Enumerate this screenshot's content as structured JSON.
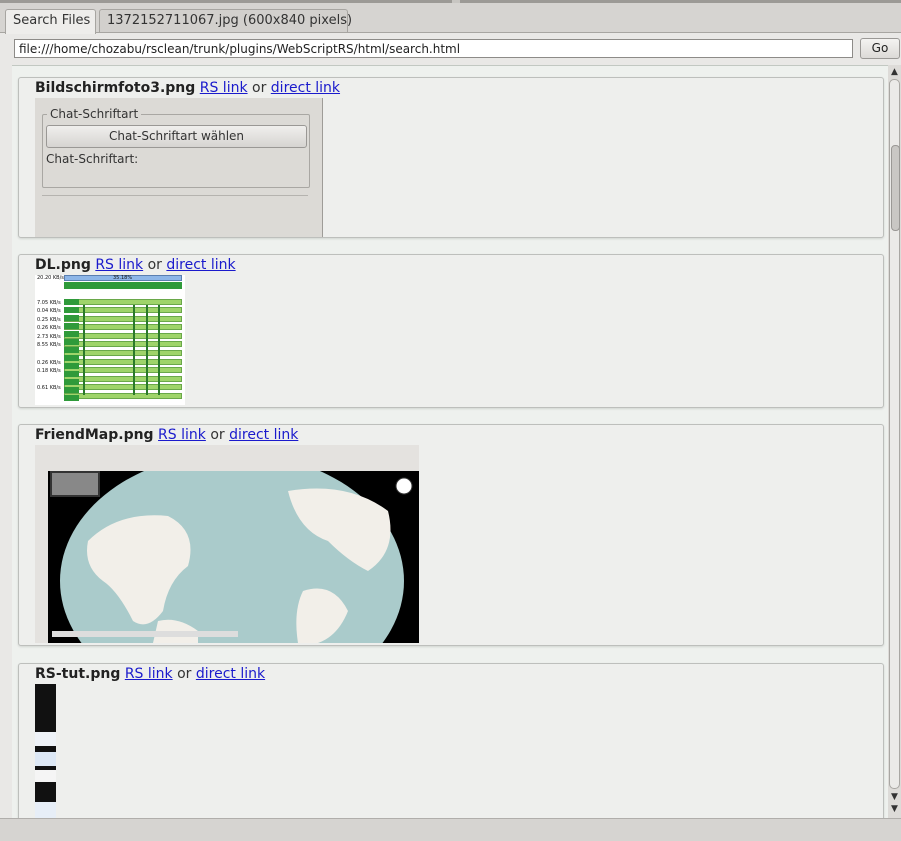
{
  "tabs": [
    {
      "label": "Search Files",
      "active": true
    },
    {
      "label": "1372152711067.jpg (600x840 pixels)",
      "active": false
    }
  ],
  "address_bar": {
    "url": "file:///home/chozabu/rsclean/trunk/plugins/WebScriptRS/html/search.html",
    "go_label": "Go"
  },
  "results": [
    {
      "filename": "Bildschirmfoto3.png",
      "rs_link_label": "RS link",
      "separator": "or",
      "direct_link_label": "direct link",
      "thumbnail": {
        "group_legend": "Chat-Schriftart",
        "button_label": "Chat-Schriftart wählen",
        "field_label": "Chat-Schriftart:"
      }
    },
    {
      "filename": "DL.png",
      "rs_link_label": "RS link",
      "separator": "or",
      "direct_link_label": "direct link",
      "thumbnail": {
        "header_rate": "20.20 KB/s",
        "header_percent": "35.18%",
        "rates": [
          "7.05 KB/s",
          "0.04 KB/s",
          "0.25 KB/s",
          "0.26 KB/s",
          "2.73 KB/s",
          "8.55 KB/s",
          "0.26 KB/s",
          "0.18 KB/s",
          "0.61 KB/s"
        ]
      }
    },
    {
      "filename": "FriendMap.png",
      "rs_link_label": "RS link",
      "separator": "or",
      "direct_link_label": "direct link"
    },
    {
      "filename": "RS-tut.png",
      "rs_link_label": "RS link",
      "separator": "or",
      "direct_link_label": "direct link"
    }
  ],
  "colors": {
    "link": "#1a1acc",
    "progress_green": "#9fd46a",
    "map_water": "#aacbcb"
  }
}
